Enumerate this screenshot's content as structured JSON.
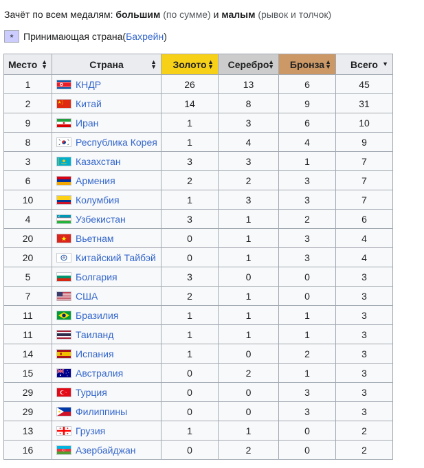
{
  "intro": {
    "prefix": "Зачёт по всем медалям: ",
    "bold1": "большим",
    "paren1": " (по сумме) ",
    "and": "и ",
    "bold2": "малым",
    "paren2": " (рывок и толчок)"
  },
  "legend": {
    "marker": "*",
    "text": "Принимающая страна",
    "open": " (",
    "host": "Бахрейн",
    "close": ")"
  },
  "headers": {
    "rank": "Место",
    "country": "Страна",
    "gold": "Золото",
    "silver": "Серебро",
    "bronze": "Бронза",
    "total": "Всего"
  },
  "colors": {
    "gold": "#f7d117",
    "silver": "#cccccc",
    "bronze": "#cc9966",
    "host": "#ccccff",
    "link": "#3366cc"
  },
  "rows": [
    {
      "rank": "1",
      "country": "КНДР",
      "flag": "north-korea",
      "gold": "26",
      "silver": "13",
      "bronze": "6",
      "total": "45"
    },
    {
      "rank": "2",
      "country": "Китай",
      "flag": "china",
      "gold": "14",
      "silver": "8",
      "bronze": "9",
      "total": "31"
    },
    {
      "rank": "9",
      "country": "Иран",
      "flag": "iran",
      "gold": "1",
      "silver": "3",
      "bronze": "6",
      "total": "10"
    },
    {
      "rank": "8",
      "country": "Республика Корея",
      "flag": "south-korea",
      "gold": "1",
      "silver": "4",
      "bronze": "4",
      "total": "9"
    },
    {
      "rank": "3",
      "country": "Казахстан",
      "flag": "kazakhstan",
      "gold": "3",
      "silver": "3",
      "bronze": "1",
      "total": "7"
    },
    {
      "rank": "6",
      "country": "Армения",
      "flag": "armenia",
      "gold": "2",
      "silver": "2",
      "bronze": "3",
      "total": "7"
    },
    {
      "rank": "10",
      "country": "Колумбия",
      "flag": "colombia",
      "gold": "1",
      "silver": "3",
      "bronze": "3",
      "total": "7"
    },
    {
      "rank": "4",
      "country": "Узбекистан",
      "flag": "uzbekistan",
      "gold": "3",
      "silver": "1",
      "bronze": "2",
      "total": "6"
    },
    {
      "rank": "20",
      "country": "Вьетнам",
      "flag": "vietnam",
      "gold": "0",
      "silver": "1",
      "bronze": "3",
      "total": "4"
    },
    {
      "rank": "20",
      "country": "Китайский Тайбэй",
      "flag": "chinese-taipei",
      "gold": "0",
      "silver": "1",
      "bronze": "3",
      "total": "4"
    },
    {
      "rank": "5",
      "country": "Болгария",
      "flag": "bulgaria",
      "gold": "3",
      "silver": "0",
      "bronze": "0",
      "total": "3"
    },
    {
      "rank": "7",
      "country": "США",
      "flag": "usa",
      "gold": "2",
      "silver": "1",
      "bronze": "0",
      "total": "3"
    },
    {
      "rank": "11",
      "country": "Бразилия",
      "flag": "brazil",
      "gold": "1",
      "silver": "1",
      "bronze": "1",
      "total": "3"
    },
    {
      "rank": "11",
      "country": "Таиланд",
      "flag": "thailand",
      "gold": "1",
      "silver": "1",
      "bronze": "1",
      "total": "3"
    },
    {
      "rank": "14",
      "country": "Испания",
      "flag": "spain",
      "gold": "1",
      "silver": "0",
      "bronze": "2",
      "total": "3"
    },
    {
      "rank": "15",
      "country": "Австралия",
      "flag": "australia",
      "gold": "0",
      "silver": "2",
      "bronze": "1",
      "total": "3"
    },
    {
      "rank": "29",
      "country": "Турция",
      "flag": "turkey",
      "gold": "0",
      "silver": "0",
      "bronze": "3",
      "total": "3"
    },
    {
      "rank": "29",
      "country": "Филиппины",
      "flag": "philippines",
      "gold": "0",
      "silver": "0",
      "bronze": "3",
      "total": "3"
    },
    {
      "rank": "13",
      "country": "Грузия",
      "flag": "georgia",
      "gold": "1",
      "silver": "1",
      "bronze": "0",
      "total": "2"
    },
    {
      "rank": "16",
      "country": "Азербайджан",
      "flag": "azerbaijan",
      "gold": "0",
      "silver": "2",
      "bronze": "0",
      "total": "2"
    }
  ]
}
